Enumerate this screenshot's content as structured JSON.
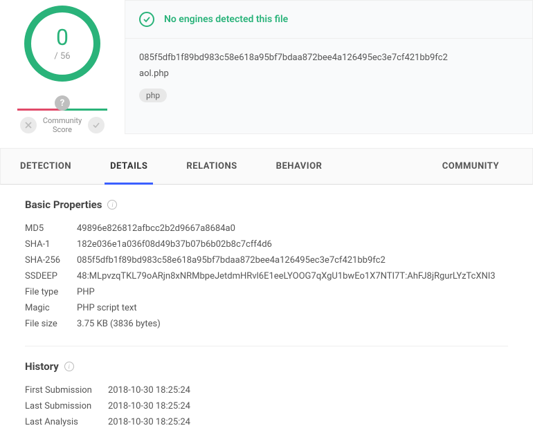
{
  "score": {
    "value": "0",
    "total": "/ 56"
  },
  "community": {
    "label_line1": "Community",
    "label_line2": "Score"
  },
  "status": {
    "text": "No engines detected this file"
  },
  "file": {
    "hash": "085f5dfb1f89bd983c58e618a95bf7bdaa872bee4a126495ec3e7cf421bb9fc2",
    "name": "aol.php",
    "tag": "php"
  },
  "tabs": [
    {
      "label": "DETECTION"
    },
    {
      "label": "DETAILS"
    },
    {
      "label": "RELATIONS"
    },
    {
      "label": "BEHAVIOR"
    },
    {
      "label": "COMMUNITY"
    }
  ],
  "basic_properties": {
    "title": "Basic Properties",
    "rows": [
      {
        "label": "MD5",
        "value": "49896e826812afbcc2b2d9667a8684a0"
      },
      {
        "label": "SHA-1",
        "value": "182e036e1a036f08d49b37b07b6b02b8c7cff4d6"
      },
      {
        "label": "SHA-256",
        "value": "085f5dfb1f89bd983c58e618a95bf7bdaa872bee4a126495ec3e7cf421bb9fc2"
      },
      {
        "label": "SSDEEP",
        "value": "48:MLpvzqTKL79oARjn8xNRMbpeJetdmHRvl6E1eeLYOOG7qXgU1bwEo1X7NTI7T:AhFJ8jRgurLYzTcXNI3"
      },
      {
        "label": "File type",
        "value": "PHP"
      },
      {
        "label": "Magic",
        "value": "PHP script text"
      },
      {
        "label": "File size",
        "value": "3.75 KB (3836 bytes)"
      }
    ]
  },
  "history": {
    "title": "History",
    "rows": [
      {
        "label": "First Submission",
        "value": "2018-10-30 18:25:24"
      },
      {
        "label": "Last Submission",
        "value": "2018-10-30 18:25:24"
      },
      {
        "label": "Last Analysis",
        "value": "2018-10-30 18:25:24"
      }
    ]
  }
}
